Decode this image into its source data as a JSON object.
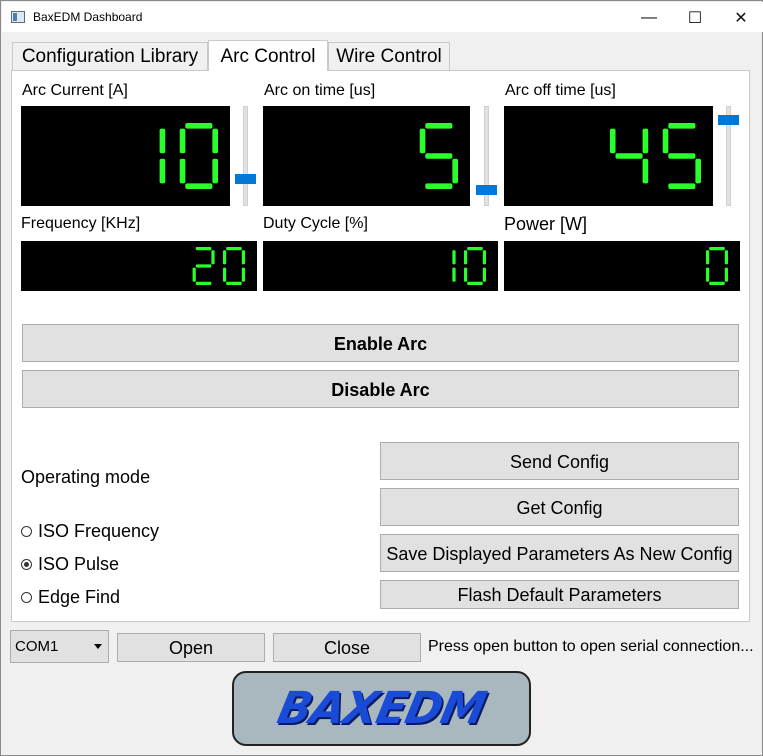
{
  "window": {
    "title": "BaxEDM Dashboard",
    "controls": {
      "minimize": "—",
      "maximize": "☐",
      "close": "✕"
    }
  },
  "tabs": [
    {
      "label": "Configuration Library",
      "active": false
    },
    {
      "label": "Arc Control",
      "active": true
    },
    {
      "label": "Wire Control",
      "active": false
    }
  ],
  "displays": {
    "arc_current": {
      "label": "Arc Current [A]",
      "value": "10",
      "slider_fraction": 0.25
    },
    "arc_on_time": {
      "label": "Arc on time [us]",
      "value": "5",
      "slider_fraction": 0.12
    },
    "arc_off_time": {
      "label": "Arc off time [us]",
      "value": "45",
      "slider_fraction": 0.9
    },
    "frequency": {
      "label": "Frequency [KHz]",
      "value": "20"
    },
    "duty_cycle": {
      "label": "Duty Cycle [%]",
      "value": "10"
    },
    "power": {
      "label": "Power [W]",
      "value": "0"
    }
  },
  "buttons": {
    "enable_arc": "Enable Arc",
    "disable_arc": "Disable Arc",
    "send_config": "Send Config",
    "get_config": "Get Config",
    "save_params": "Save Displayed Parameters As New Config",
    "flash_default": "Flash Default Parameters",
    "open": "Open",
    "close": "Close"
  },
  "operating_mode": {
    "label": "Operating mode",
    "options": [
      {
        "label": "ISO Frequency",
        "selected": false
      },
      {
        "label": "ISO Pulse",
        "selected": true
      },
      {
        "label": "Edge Find",
        "selected": false
      }
    ]
  },
  "serial": {
    "port": "COM1",
    "status": "Press open button to open serial connection..."
  },
  "logo": {
    "text": "BAXEDM"
  },
  "colors": {
    "lcd_digit": "#2bff2b",
    "lcd_bg": "#000000",
    "slider": "#0078d7"
  }
}
